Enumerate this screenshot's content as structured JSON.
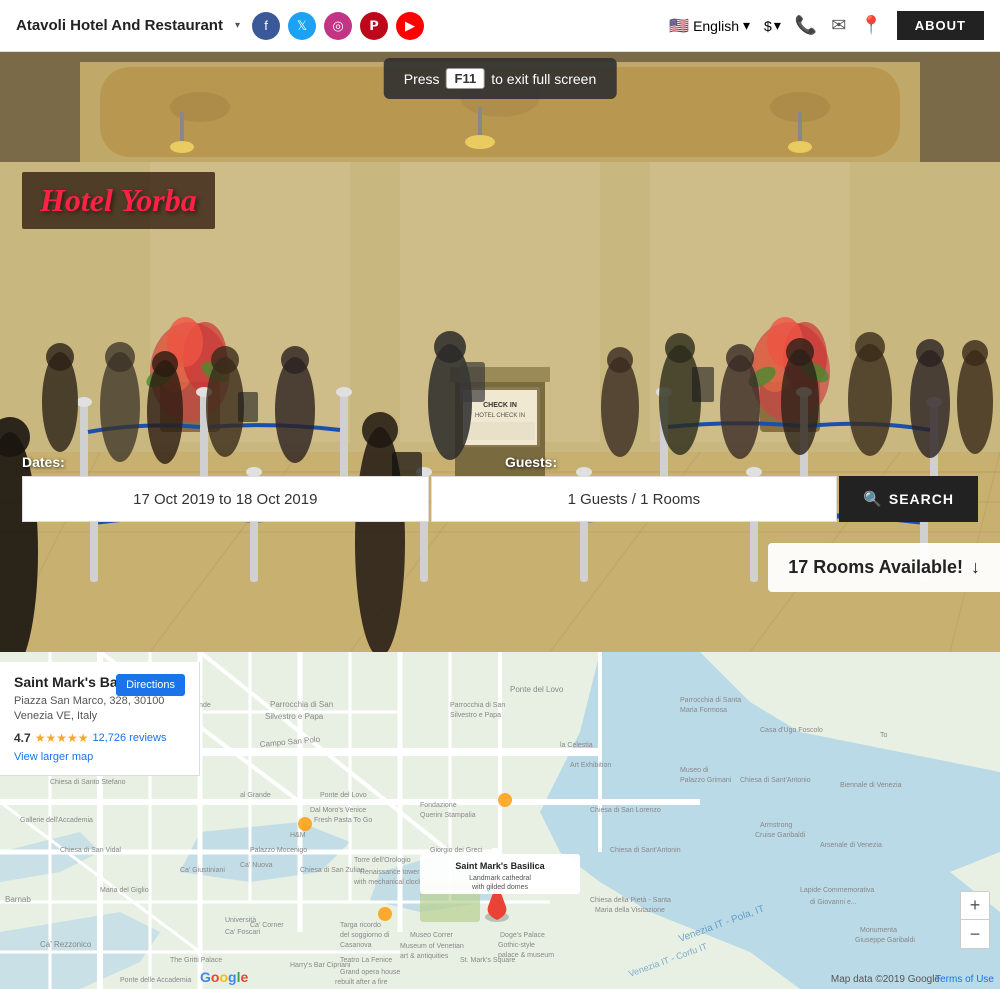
{
  "header": {
    "site_title": "Atavoli Hotel And Restaurant",
    "dropdown_arrow": "▾",
    "social": [
      {
        "name": "Facebook",
        "char": "f",
        "class": "social-fb"
      },
      {
        "name": "Twitter",
        "char": "t",
        "class": "social-tw"
      },
      {
        "name": "Instagram",
        "char": "📷",
        "class": "social-ig"
      },
      {
        "name": "Pinterest",
        "char": "p",
        "class": "social-pt"
      },
      {
        "name": "YouTube",
        "char": "▶",
        "class": "social-yt"
      }
    ],
    "language": "English",
    "language_dropdown": "▾",
    "currency": "$",
    "currency_dropdown": "▾",
    "about_label": "ABOUT"
  },
  "fullscreen_tooltip": {
    "prefix": "Press",
    "key": "F11",
    "suffix": "to exit full screen"
  },
  "hero": {
    "hotel_name": "Hotel Yorba",
    "dates_label": "Dates:",
    "date_value": "17 Oct 2019 to 18 Oct 2019",
    "guests_label": "Guests:",
    "guests_value": "1 Guests / 1 Rooms",
    "search_label": "SEARCH"
  },
  "rooms_badge": {
    "text": "17 Rooms Available!",
    "arrow": "↓"
  },
  "map": {
    "place_name": "Saint Mark's Basilica",
    "address_line1": "Piazza San Marco, 328, 30100",
    "address_line2": "Venezia VE, Italy",
    "rating": "4.7",
    "stars": "★★★★★",
    "review_count": "12,726 reviews",
    "view_larger": "View larger map",
    "directions_label": "Directions",
    "attribution": "Map data ©2019 Google",
    "terms": "Terms of Use",
    "google_text": "Google"
  },
  "zoom": {
    "plus": "+",
    "minus": "−"
  }
}
